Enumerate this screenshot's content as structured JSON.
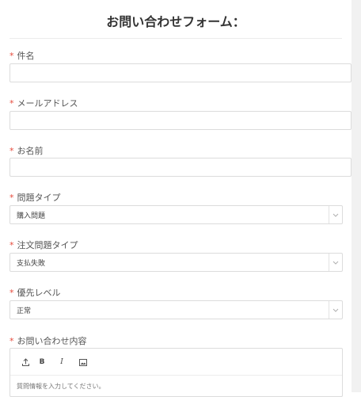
{
  "form": {
    "title": "お問い合わせフォーム：",
    "required_mark": "*",
    "fields": {
      "subject": {
        "label": "件名",
        "value": ""
      },
      "email": {
        "label": "メールアドレス",
        "value": ""
      },
      "name": {
        "label": "お名前",
        "value": ""
      },
      "issue_type": {
        "label": "問題タイプ",
        "selected": "購入問題"
      },
      "order_issue_type": {
        "label": "注文問題タイプ",
        "selected": "支払失敗"
      },
      "priority": {
        "label": "優先レベル",
        "selected": "正常"
      },
      "content": {
        "label": "お問い合わせ内容",
        "placeholder": "質問情報を入力してください。",
        "toolbar": {
          "upload_icon": "upload-icon",
          "bold_glyph": "B",
          "italic_glyph": "I",
          "image_icon": "image-icon"
        }
      }
    }
  },
  "icons": {
    "select_arrow": "chevron-down-icon"
  },
  "colors": {
    "required": "#e64a3b",
    "border": "#dcdcdc"
  }
}
